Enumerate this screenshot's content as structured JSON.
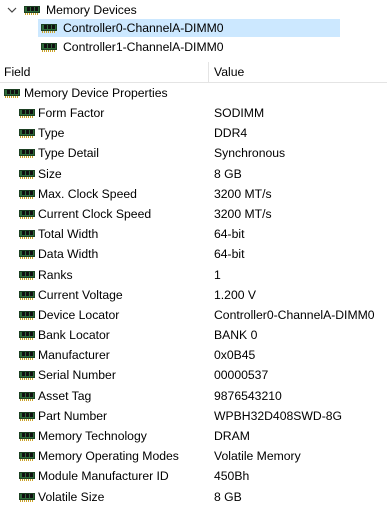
{
  "tree": {
    "root_label": "Memory Devices",
    "children": [
      {
        "label": "Controller0-ChannelA-DIMM0",
        "selected": true
      },
      {
        "label": "Controller1-ChannelA-DIMM0",
        "selected": false
      }
    ]
  },
  "table": {
    "headers": {
      "field": "Field",
      "value": "Value"
    },
    "group_label": "Memory Device Properties",
    "rows": [
      {
        "field": "Form Factor",
        "value": "SODIMM"
      },
      {
        "field": "Type",
        "value": "DDR4"
      },
      {
        "field": "Type Detail",
        "value": "Synchronous"
      },
      {
        "field": "Size",
        "value": "8 GB"
      },
      {
        "field": "Max. Clock Speed",
        "value": "3200 MT/s"
      },
      {
        "field": "Current Clock Speed",
        "value": "3200 MT/s"
      },
      {
        "field": "Total Width",
        "value": "64-bit"
      },
      {
        "field": "Data Width",
        "value": "64-bit"
      },
      {
        "field": "Ranks",
        "value": "1"
      },
      {
        "field": "Current Voltage",
        "value": "1.200 V"
      },
      {
        "field": "Device Locator",
        "value": "Controller0-ChannelA-DIMM0"
      },
      {
        "field": "Bank Locator",
        "value": "BANK 0"
      },
      {
        "field": "Manufacturer",
        "value": "0x0B45"
      },
      {
        "field": "Serial Number",
        "value": "00000537"
      },
      {
        "field": "Asset Tag",
        "value": "9876543210"
      },
      {
        "field": "Part Number",
        "value": "WPBH32D408SWD-8G"
      },
      {
        "field": "Memory Technology",
        "value": "DRAM"
      },
      {
        "field": "Memory Operating Modes",
        "value": "Volatile Memory"
      },
      {
        "field": "Module Manufacturer ID",
        "value": "450Bh"
      },
      {
        "field": "Volatile Size",
        "value": "8 GB"
      }
    ]
  },
  "icons": {
    "tree_expand": "chevron-down-icon",
    "item": "memory-module-icon"
  },
  "colors": {
    "selection": "#cce8ff",
    "module_board": "#2f6b3a",
    "pins": "#c9a227"
  }
}
